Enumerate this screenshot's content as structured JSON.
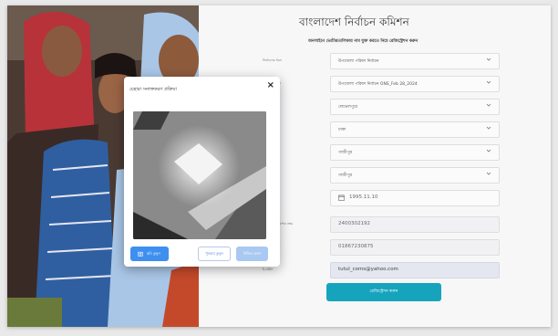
{
  "header": {
    "title": "বাংলাদেশ নির্বাচন কমিশন",
    "subtitle": "অনলাইনে ভোটারতালিকায় নাম যুক্ত করতে নিচে রেজিস্ট্রেশন করুন"
  },
  "form": {
    "rows": [
      {
        "label": "নির্বাচনের ধরন",
        "value": "উপজেলা পরিষদ নির্বাচন",
        "type": "select"
      },
      {
        "label": "নির্বাচনের নাম",
        "value": "উপজেলা পরিষদ নির্বাচন ONS_Feb 28_2024",
        "type": "select"
      },
      {
        "label": "",
        "value": "লেভেলপুরে",
        "type": "select"
      },
      {
        "label": "",
        "value": "ঢাকা",
        "type": "select"
      },
      {
        "label": "",
        "value": "গাজীপুর",
        "type": "select"
      },
      {
        "label": "",
        "value": "গাজীপুর",
        "type": "select"
      },
      {
        "label": "",
        "value": "1995.11.10",
        "type": "date"
      },
      {
        "label": "জাতীয় পরিচয়পত্র নম্বর",
        "value": "2400302192",
        "type": "text"
      },
      {
        "label": "মোবাইল নম্বর",
        "value": "01867230875",
        "type": "text"
      },
      {
        "label": "ই-মেইল",
        "value": "tutul_coms@yahoo.com",
        "type": "email"
      }
    ],
    "submit_label": "রেজিস্ট্রেশন করুন"
  },
  "modal": {
    "title": "চেহারা সনাক্তকরণ প্রক্রিয়া",
    "close": "×",
    "btn_photo": "ছবি তুলুন",
    "btn_retake": "পুনরায় তুলুন",
    "btn_confirm": "নিশ্চিত করুন"
  },
  "colors": {
    "accent": "#16a4bd",
    "primary_button": "#3d8ff0",
    "disabled_button": "#a9c8f2"
  }
}
